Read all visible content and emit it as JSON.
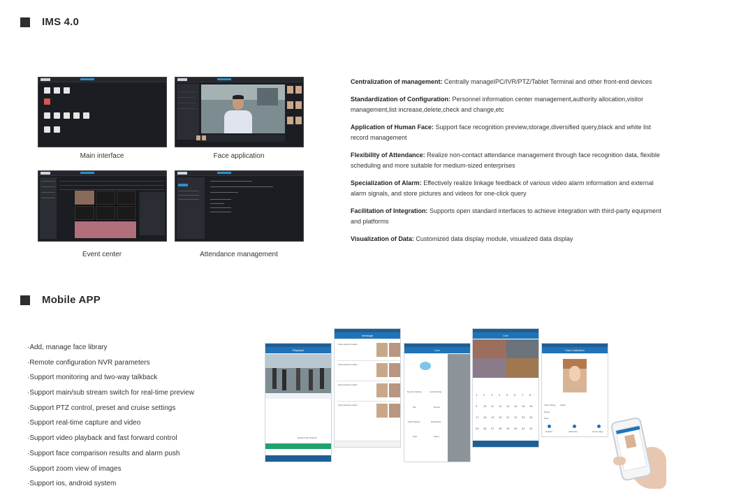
{
  "ims": {
    "title": "IMS  4.0",
    "screens": [
      {
        "caption": "Main interface"
      },
      {
        "caption": "Face application"
      },
      {
        "caption": "Event center"
      },
      {
        "caption": "Attendance management"
      }
    ],
    "features": [
      {
        "label": "Centralization of management:",
        "text": " Centrally manageIPC/IVR/PTZ/Tablet Terminal and other front-end devices"
      },
      {
        "label": "Standardization of Configuration:",
        "text": " Personnel information center management,authority allocation,visitor management,list increase,delete,check and change,etc"
      },
      {
        "label": "Application of Human Face:",
        "text": " Support face recognition preview,storage,diversified query,black and white list record management"
      },
      {
        "label": "Flexibility of Attendance:",
        "text": " Realize non-contact attendance management through face recognition data, flexible scheduling and more suitable for medium-sized enterprises"
      },
      {
        "label": "Specialization of Alarm:",
        "text": " Effectively realize linkage feedback of various video alarm information and external alarm signals, and store pictures and videos for one-click query"
      },
      {
        "label": "Facilitation of Integration:",
        "text": " Supports open standard interfaces to achieve integration with third-party equipment and platforms"
      },
      {
        "label": "Visualization of Data:",
        "text": " Customized data display module, visualized data display"
      }
    ]
  },
  "mobile": {
    "title": "Mobile APP",
    "items": [
      "·Add, manage face library",
      "·Remote configuration NVR parameters",
      "·Support monitoring and two-way talkback",
      "·Support main/sub stream switch for real-time preview",
      "·Support PTZ control, preset and cruise settings",
      "·Support real-time capture and video",
      "·Support video playback and fast forward control",
      "·Support face comparison results and alarm push",
      "·Support zoom view of images",
      "·Support ios, android system"
    ],
    "phones": {
      "playback": {
        "title": "Playback",
        "timestamp": "2018-04-25 10:00:47"
      },
      "message": {
        "title": "message",
        "alert": "Face detection alarm"
      },
      "live1": {
        "title": "Live",
        "items": [
          "Remote Setting",
          "Local Setting",
          "File",
          "Device",
          "Push Setting",
          "Notification",
          "Help",
          "About"
        ]
      },
      "live2": {
        "title": "Live",
        "nums": [
          "1",
          "2",
          "3",
          "4",
          "5",
          "6",
          "7",
          "8",
          "9",
          "10",
          "11",
          "12",
          "13",
          "14",
          "15",
          "16",
          "17",
          "18",
          "19",
          "20",
          "21",
          "22",
          "23",
          "24",
          "25",
          "26",
          "27",
          "28",
          "29",
          "30",
          "31",
          "32"
        ]
      },
      "face": {
        "title": "Face Collection",
        "fields": [
          "Face Library",
          "Name",
          "Note"
        ],
        "library_value": "public",
        "buttons": [
          "Upload",
          "Add Face...",
          "Home page"
        ]
      }
    }
  }
}
